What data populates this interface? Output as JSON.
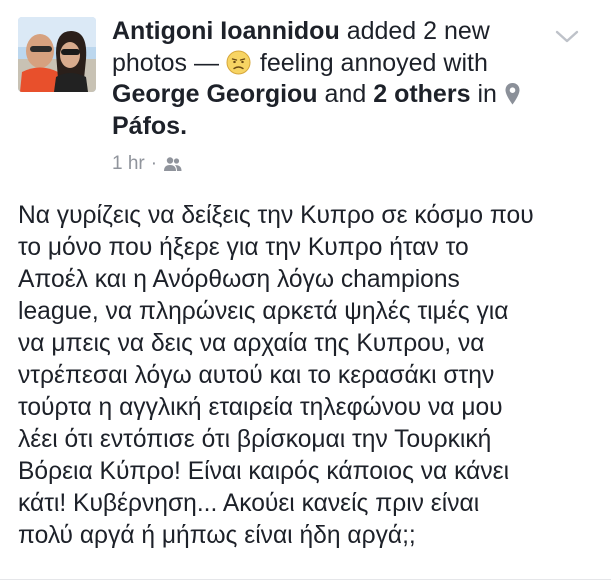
{
  "post": {
    "author": "Antigoni Ioannidou",
    "action": "added 2 new photos —",
    "feeling_text": "feeling annoyed",
    "with_text": "with",
    "tagged_person": "George Georgiou",
    "and_text": "and",
    "others_text": "2 others",
    "in_text": "in",
    "location": "Páfos.",
    "timestamp": "1 hr",
    "separator": "·",
    "audience_icon": "friends-icon",
    "feeling_icon": "annoyed-face-icon",
    "location_icon": "location-pin-icon",
    "menu_icon": "chevron-down-icon",
    "body_lines": [
      "Να γυρίζεις να δείξεις την Κυπρο σε κόσμο που",
      "το μόνο που ήξερε για την Κυπρο ήταν το",
      "Αποέλ και η Ανόρθωση λόγω champions",
      "league, να πληρώνεις αρκετά ψηλές τιμές για",
      "να μπεις να δεις να αρχαία της Κυπρου, να",
      "ντρέπεσαι λόγω αυτού και το κερασάκι στην",
      "τούρτα η αγγλική εταιρεία τηλεφώνου να μου",
      "λέει ότι εντόπισε ότι βρίσκομαι την Τουρκική",
      "Βόρεια Κύπρο! Είναι καιρός κάποιος να κάνει",
      "κάτι! Κυβέρνηση... Ακούει κανείς πριν είναι",
      "πολύ αργά ή μήπως είναι ήδη αργά;;"
    ]
  },
  "colors": {
    "text": "#1d2129",
    "meta": "#90949c",
    "icon_grey": "#bec2c9"
  }
}
